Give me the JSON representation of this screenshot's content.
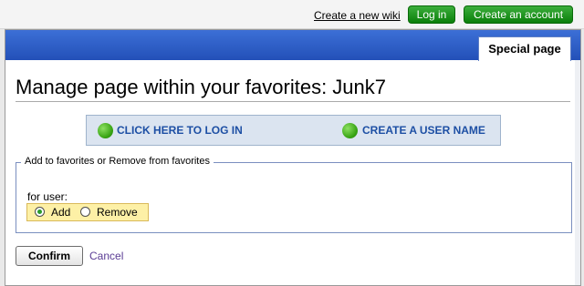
{
  "header": {
    "create_wiki_link": "Create a new wiki",
    "login_button": "Log in",
    "create_account_button": "Create an account"
  },
  "tab": {
    "label": "Special page"
  },
  "page": {
    "title": "Manage page within your favorites: Junk7"
  },
  "login_box": {
    "login_link": "CLICK HERE TO LOG IN",
    "create_user_link": "CREATE A USER NAME"
  },
  "form": {
    "legend": "Add to favorites or Remove from favorites",
    "for_user_label": "for user:",
    "options": [
      {
        "label": "Add",
        "checked": true
      },
      {
        "label": "Remove",
        "checked": false
      }
    ],
    "confirm_button": "Confirm",
    "cancel_link": "Cancel"
  },
  "colors": {
    "green_button": "#1a941a",
    "blue_band": "#2c5fc8",
    "link_blue": "#1d4fa4",
    "radio_highlight": "#fdf0a6"
  }
}
